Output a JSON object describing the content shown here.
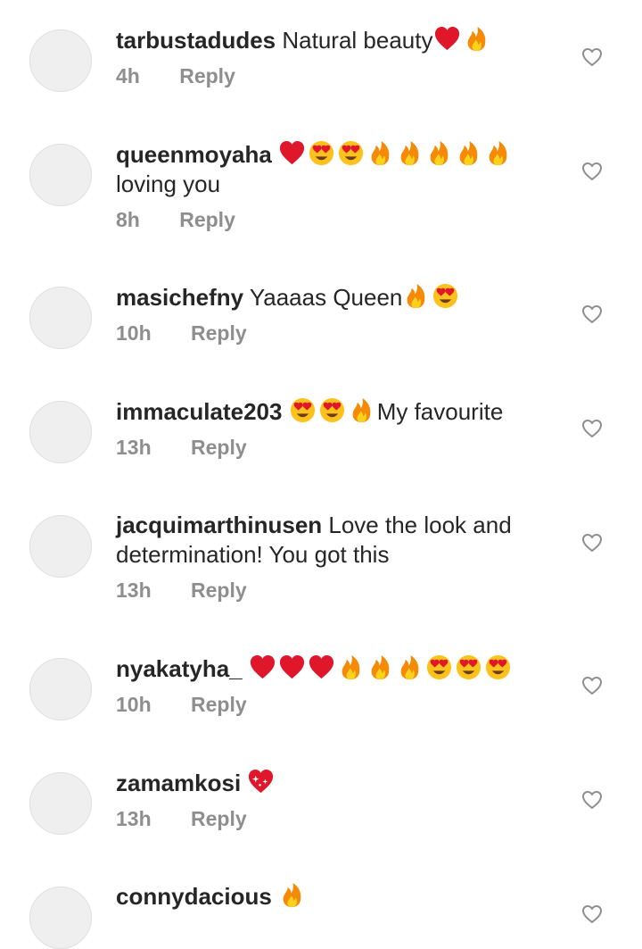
{
  "comments": [
    {
      "user": "tarbustadudes",
      "text": "Natural beauty",
      "emojis_after": [
        "heart",
        "fire"
      ],
      "emojis_before": [],
      "time": "4h",
      "reply": "Reply"
    },
    {
      "user": "queenmoyaha",
      "text": "loving you",
      "emojis_before": [
        "heart",
        "heart-eyes",
        "heart-eyes",
        "fire",
        "fire",
        "fire",
        "fire",
        "fire"
      ],
      "emojis_after": [],
      "time": "8h",
      "reply": "Reply"
    },
    {
      "user": "masichefny",
      "text": "Yaaaas Queen",
      "emojis_after": [
        "fire",
        "heart-eyes"
      ],
      "emojis_before": [],
      "time": "10h",
      "reply": "Reply"
    },
    {
      "user": "immaculate203",
      "text": "My favourite",
      "emojis_before": [
        "heart-eyes",
        "heart-eyes",
        "fire"
      ],
      "emojis_after": [],
      "time": "13h",
      "reply": "Reply"
    },
    {
      "user": "jacquimarthinusen",
      "text": "Love the look and determination! You got this",
      "emojis_before": [],
      "emojis_after": [],
      "time": "13h",
      "reply": "Reply"
    },
    {
      "user": "nyakatyha_",
      "text": "",
      "emojis_before": [
        "heart",
        "heart",
        "heart",
        "fire",
        "fire",
        "fire",
        "heart-eyes",
        "heart-eyes",
        "heart-eyes"
      ],
      "emojis_after": [],
      "time": "10h",
      "reply": "Reply"
    },
    {
      "user": "zamamkosi",
      "text": "",
      "emojis_before": [
        "sparkling-heart"
      ],
      "emojis_after": [],
      "time": "13h",
      "reply": "Reply"
    },
    {
      "user": "connydacious",
      "text": "",
      "emojis_before": [
        "fire"
      ],
      "emojis_after": [],
      "time": "",
      "reply": ""
    }
  ],
  "icons": {
    "like": "heart-outline-icon"
  },
  "colors": {
    "text": "#262626",
    "meta": "#8e8e8e",
    "avatar": "#efefef",
    "heart": "#e0162b",
    "fire": "#f58a07"
  }
}
